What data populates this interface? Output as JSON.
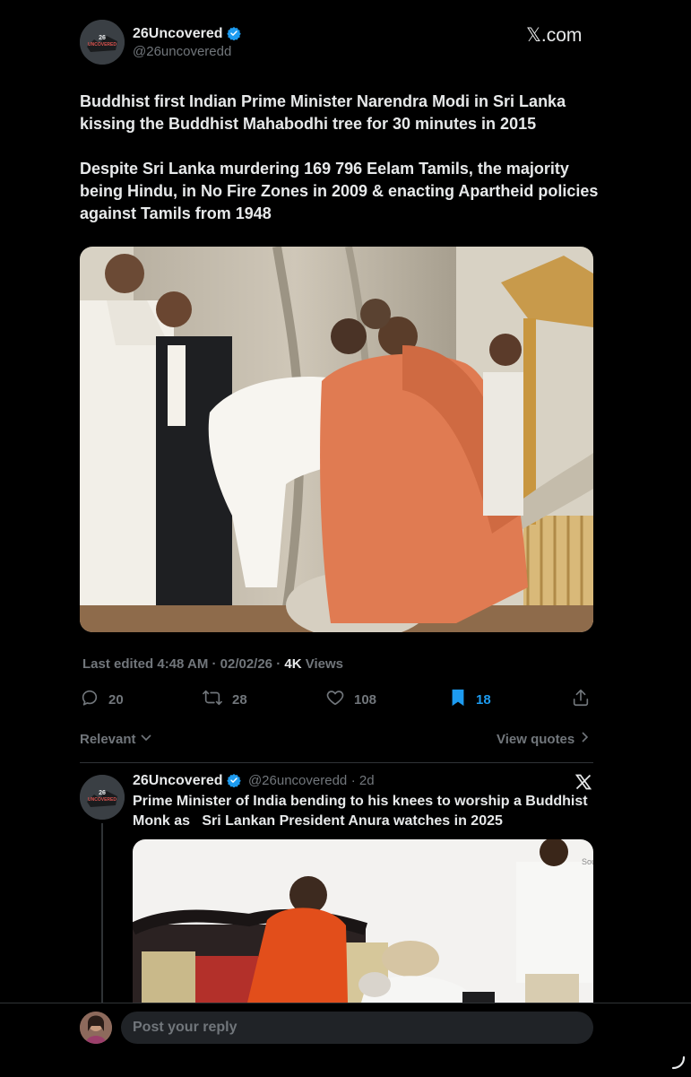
{
  "header": {
    "display_name": "26Uncovered",
    "handle": "@26uncoveredd",
    "source_label": "𝕏.com",
    "avatar_text": "26 UNCOVERED"
  },
  "tweet": {
    "text": "Buddhist first Indian Prime Minister Narendra Modi in Sri Lanka kissing the Buddhist Mahabodhi tree for 30 minutes in 2015\n\nDespite Sri Lanka murdering 169 796 Eelam Tamils, the majority being Hindu, in No Fire Zones in 2009 & enacting Apartheid policies against Tamils from 1948",
    "meta_prefix": "Last edited 4:48 AM · 02/02/26 · ",
    "views_count": "4K",
    "views_label": " Views",
    "actions": {
      "replies": "20",
      "reposts": "28",
      "likes": "108",
      "bookmarks": "18"
    }
  },
  "filter": {
    "sort_label": "Relevant",
    "view_quotes_label": "View quotes"
  },
  "reply": {
    "display_name": "26Uncovered",
    "handle": "@26uncoveredd",
    "time": "· 2d",
    "text": "Prime Minister of India bending to his knees to worship a Buddhist Monk as   Sri Lankan President Anura watches in 2025",
    "image_watermark": "Sou"
  },
  "composer": {
    "placeholder": "Post your reply"
  },
  "colors": {
    "background": "#000000",
    "text_primary": "#e7e9ea",
    "text_secondary": "#71767b",
    "accent": "#1d9bf0",
    "divider": "#2f3336"
  }
}
